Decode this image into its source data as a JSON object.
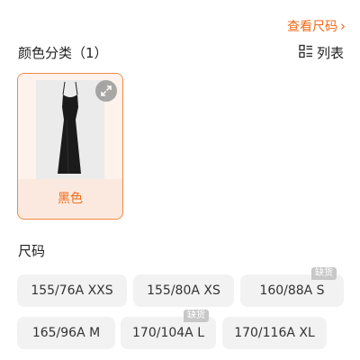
{
  "header": {
    "size_guide_label": "查看尺码",
    "size_guide_chevron": "›",
    "color_section_title": "颜色分类（1）",
    "list_toggle_label": "列表"
  },
  "colors": [
    {
      "label": "黑色",
      "selected": true,
      "accent": "#f06b18"
    }
  ],
  "size_section_title": "尺码",
  "sizes": [
    {
      "label": "155/76A XXS",
      "badge": ""
    },
    {
      "label": "155/80A XS",
      "badge": ""
    },
    {
      "label": "160/88A S",
      "badge": "缺货"
    },
    {
      "label": "165/96A M",
      "badge": ""
    },
    {
      "label": "170/104A L",
      "badge": "缺货"
    },
    {
      "label": "170/116A XL",
      "badge": ""
    }
  ],
  "icons": {
    "list": "list-icon",
    "expand": "expand-icon",
    "chevron": "chevron-right-icon"
  }
}
